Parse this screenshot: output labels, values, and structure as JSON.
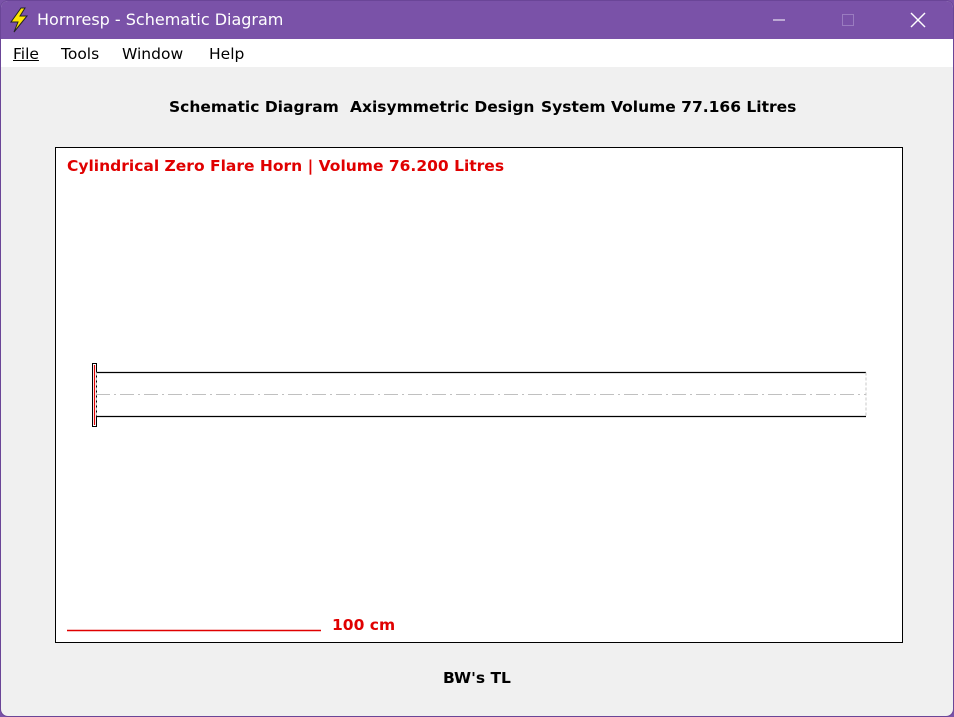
{
  "window": {
    "title": "Hornresp - Schematic Diagram",
    "icon": "lightning-bolt-icon",
    "controls": [
      "minimize-icon",
      "maximize-icon",
      "close-icon"
    ],
    "accent": "#7a52a8"
  },
  "menu": {
    "file": "File",
    "tools": "Tools",
    "window": "Window",
    "help": "Help"
  },
  "header": {
    "view": "Schematic Diagram",
    "design": "Axisymmetric Design",
    "volume": "System Volume 77.166 Litres"
  },
  "diagram": {
    "title": "Cylindrical Zero Flare Horn | Volume 76.200 Litres",
    "scale_label": "100 cm",
    "title_color": "#e00000"
  },
  "footer": {
    "label": "BW's TL"
  }
}
